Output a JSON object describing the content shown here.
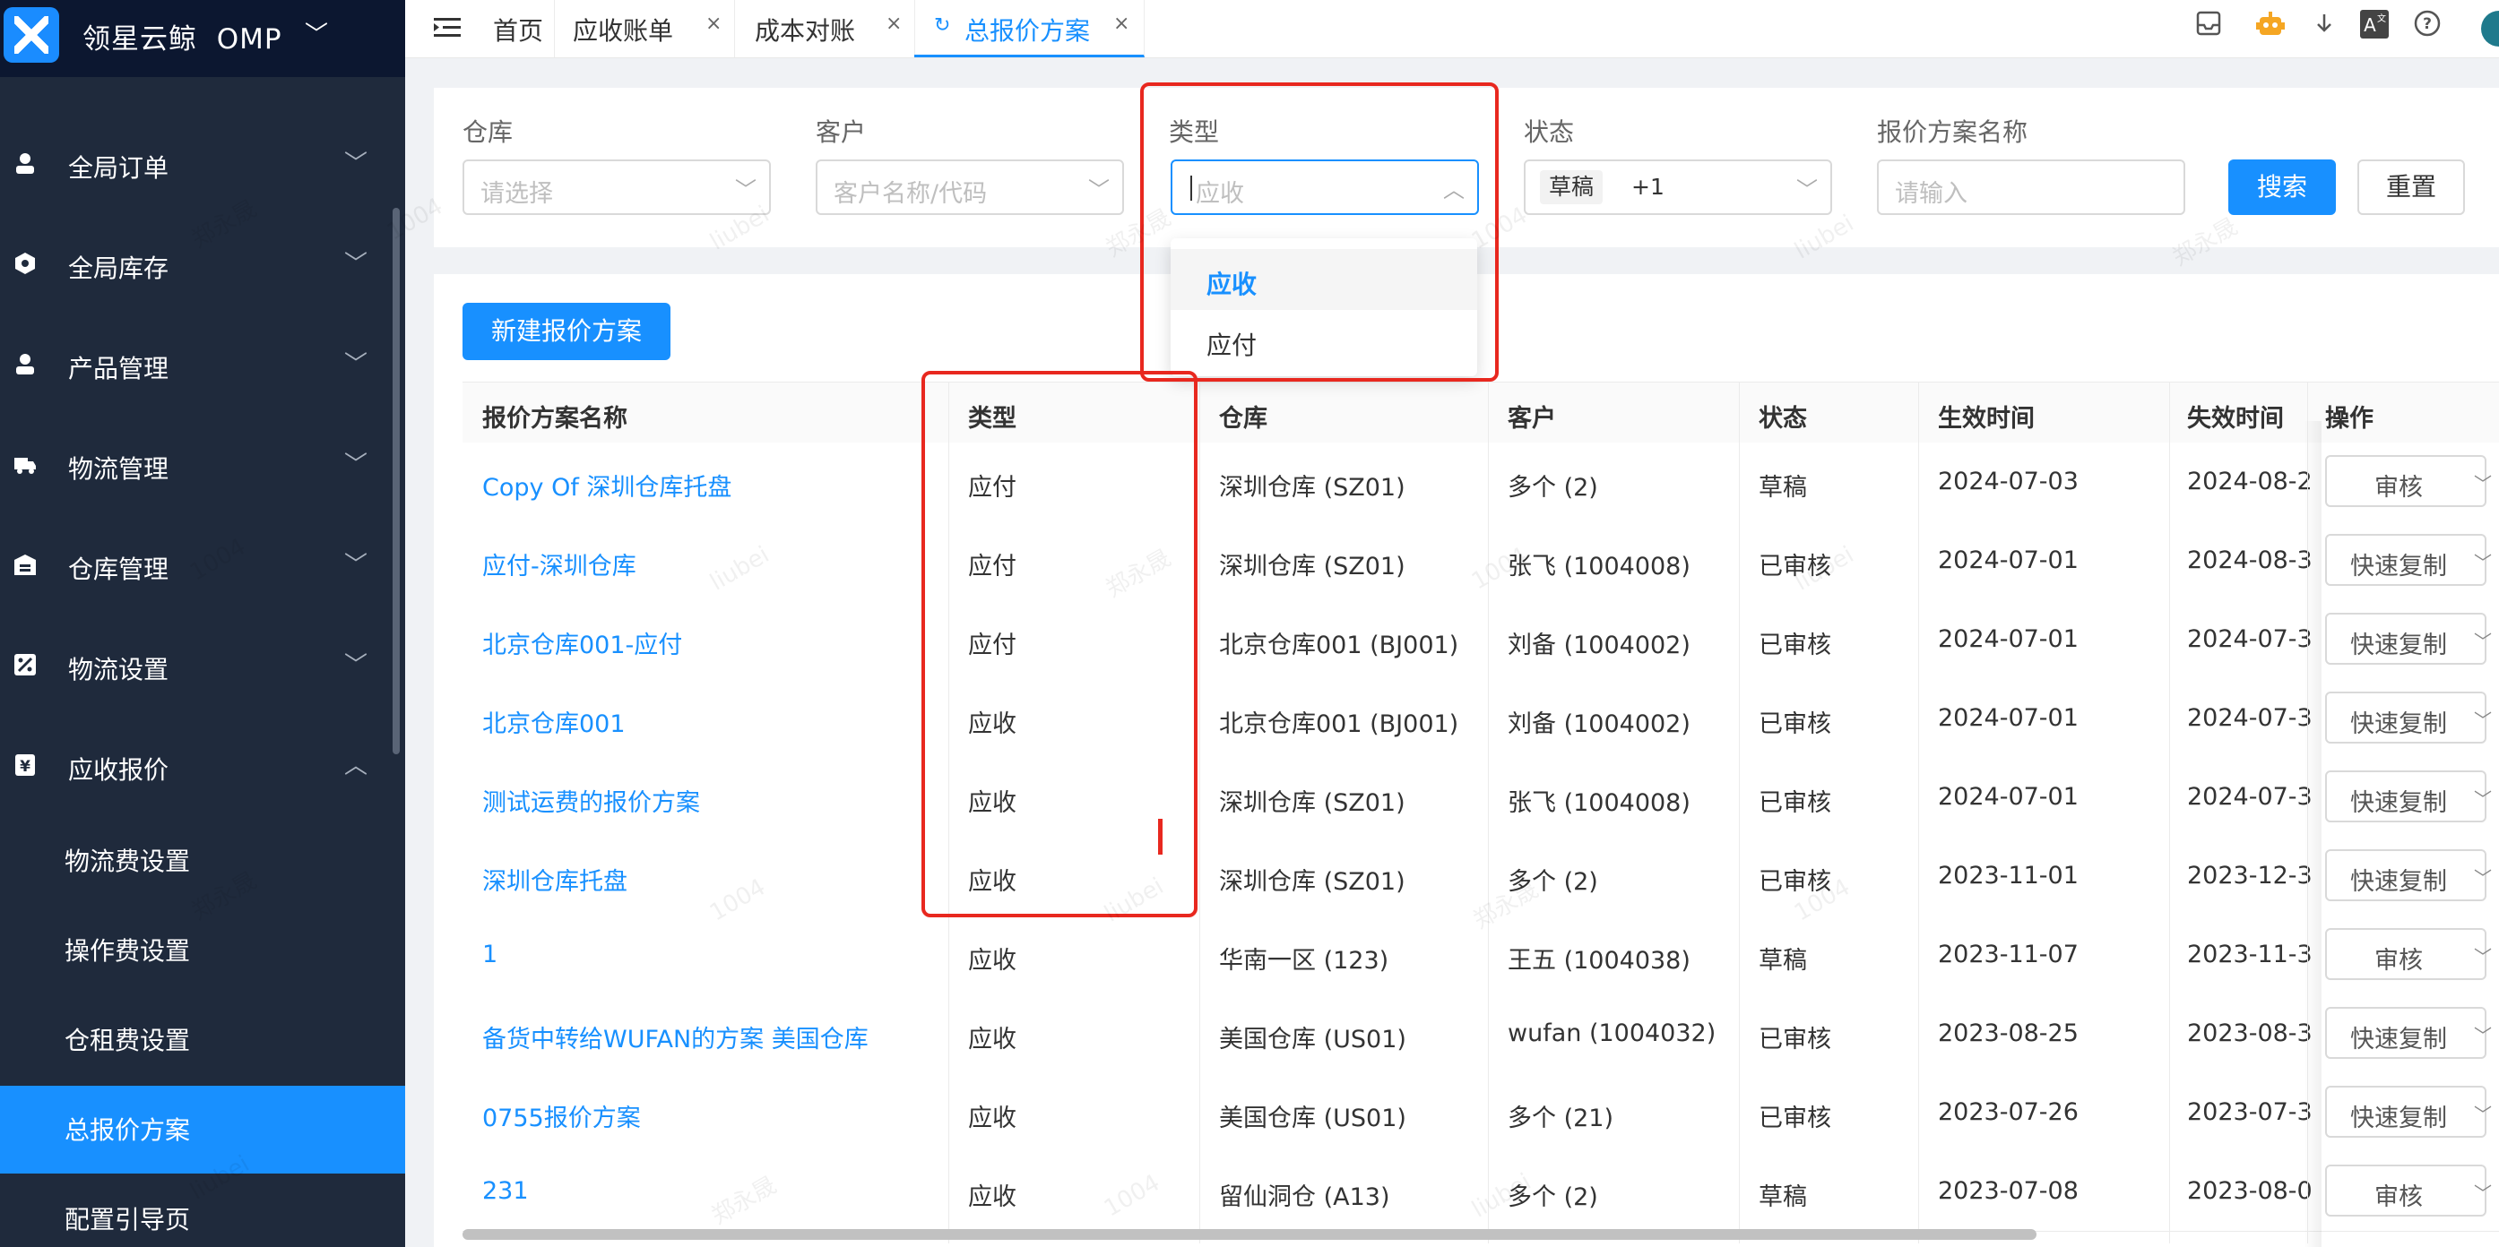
{
  "app": {
    "name": "领星云鲸",
    "product": "OMP"
  },
  "sidebar": {
    "menu": [
      {
        "label": "全局订单",
        "icon": "user-icon"
      },
      {
        "label": "全局库存",
        "icon": "hexagon-icon"
      },
      {
        "label": "产品管理",
        "icon": "user-icon"
      },
      {
        "label": "物流管理",
        "icon": "truck-icon"
      },
      {
        "label": "仓库管理",
        "icon": "warehouse-icon"
      },
      {
        "label": "物流设置",
        "icon": "percent-icon"
      },
      {
        "label": "应收报价",
        "icon": "yen-icon"
      }
    ],
    "submenu": [
      {
        "label": "物流费设置"
      },
      {
        "label": "操作费设置"
      },
      {
        "label": "仓租费设置"
      },
      {
        "label": "总报价方案",
        "active": true
      },
      {
        "label": "配置引导页"
      }
    ]
  },
  "tabs": [
    {
      "label": "首页"
    },
    {
      "label": "应收账单"
    },
    {
      "label": "成本对账"
    },
    {
      "label": "总报价方案",
      "active": true
    }
  ],
  "filters": {
    "warehouse": {
      "label": "仓库",
      "placeholder": "请选择"
    },
    "customer": {
      "label": "客户",
      "placeholder": "客户名称/代码"
    },
    "type": {
      "label": "类型",
      "placeholder": "应收"
    },
    "status": {
      "label": "状态",
      "tag": "草稿",
      "more": "+1"
    },
    "name": {
      "label": "报价方案名称",
      "placeholder": "请输入"
    },
    "search_label": "搜索",
    "reset_label": "重置"
  },
  "type_dropdown": {
    "options": [
      "应收",
      "应付"
    ],
    "selected": "应收"
  },
  "new_button_label": "新建报价方案",
  "table": {
    "columns": [
      "报价方案名称",
      "类型",
      "仓库",
      "客户",
      "状态",
      "生效时间",
      "失效时间",
      "操作"
    ],
    "rows": [
      {
        "name": "Copy Of 深圳仓库托盘",
        "type": "应付",
        "warehouse": "深圳仓库 (SZ01)",
        "customer": "多个 (2)",
        "status": "草稿",
        "start": "2024-07-03",
        "end": "2024-08-2",
        "op": "审核"
      },
      {
        "name": "应付-深圳仓库",
        "type": "应付",
        "warehouse": "深圳仓库 (SZ01)",
        "customer": "张飞 (1004008)",
        "status": "已审核",
        "start": "2024-07-01",
        "end": "2024-08-3",
        "op": "快速复制"
      },
      {
        "name": "北京仓库001-应付",
        "type": "应付",
        "warehouse": "北京仓库001 (BJ001)",
        "customer": "刘备 (1004002)",
        "status": "已审核",
        "start": "2024-07-01",
        "end": "2024-07-3",
        "op": "快速复制"
      },
      {
        "name": "北京仓库001",
        "type": "应收",
        "warehouse": "北京仓库001 (BJ001)",
        "customer": "刘备 (1004002)",
        "status": "已审核",
        "start": "2024-07-01",
        "end": "2024-07-3",
        "op": "快速复制"
      },
      {
        "name": "测试运费的报价方案",
        "type": "应收",
        "warehouse": "深圳仓库 (SZ01)",
        "customer": "张飞 (1004008)",
        "status": "已审核",
        "start": "2024-07-01",
        "end": "2024-07-3",
        "op": "快速复制"
      },
      {
        "name": "深圳仓库托盘",
        "type": "应收",
        "warehouse": "深圳仓库 (SZ01)",
        "customer": "多个 (2)",
        "status": "已审核",
        "start": "2023-11-01",
        "end": "2023-12-3",
        "op": "快速复制"
      },
      {
        "name": "1",
        "type": "应收",
        "warehouse": "华南一区 (123)",
        "customer": "王五 (1004038)",
        "status": "草稿",
        "start": "2023-11-07",
        "end": "2023-11-3",
        "op": "审核"
      },
      {
        "name": "备货中转给WUFAN的方案 美国仓库",
        "type": "应收",
        "warehouse": "美国仓库 (US01)",
        "customer": "wufan (1004032)",
        "status": "已审核",
        "start": "2023-08-25",
        "end": "2023-08-3",
        "op": "快速复制"
      },
      {
        "name": "0755报价方案",
        "type": "应收",
        "warehouse": "美国仓库 (US01)",
        "customer": "多个 (21)",
        "status": "已审核",
        "start": "2023-07-26",
        "end": "2023-07-3",
        "op": "快速复制"
      },
      {
        "name": "231",
        "type": "应收",
        "warehouse": "留仙洞仓 (A13)",
        "customer": "多个 (2)",
        "status": "草稿",
        "start": "2023-07-08",
        "end": "2023-08-0",
        "op": "审核"
      }
    ]
  },
  "watermark": [
    "郑永晟",
    "1004",
    "liubei"
  ],
  "colors": {
    "primary": "#1890ff",
    "sidebar_bg": "#1f2a3c",
    "annotation": "#e8281f"
  }
}
